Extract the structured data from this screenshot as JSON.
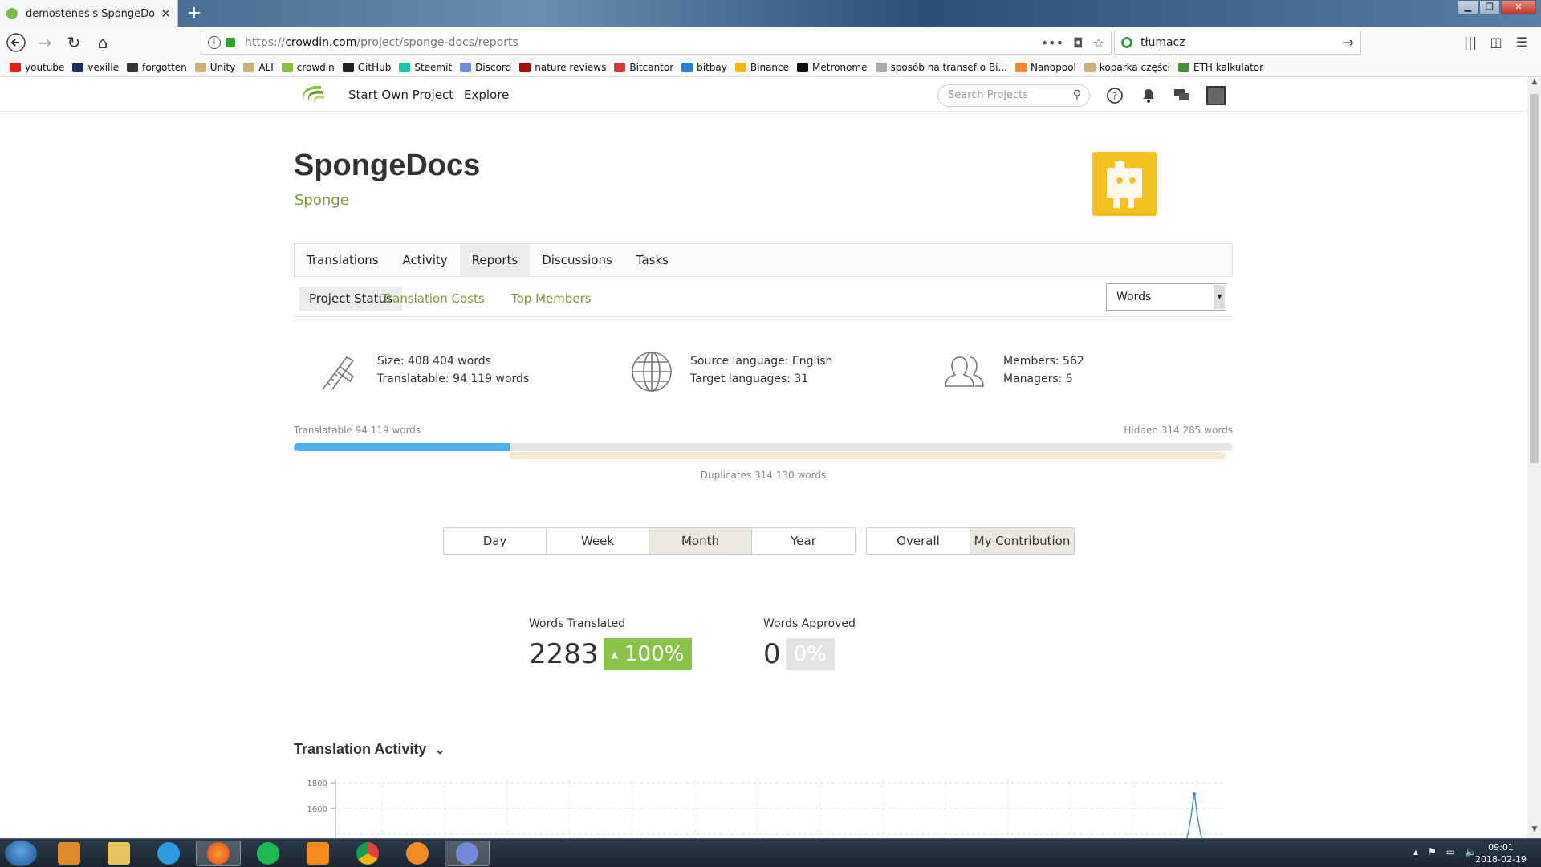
{
  "browser": {
    "tab_title": "demostenes's SpongeDocs Tra",
    "url_prefix": "https://",
    "url_domain": "crowdin.com",
    "url_path": "/project/sponge-docs/reports",
    "search_value": "tłumacz"
  },
  "bookmarks": [
    {
      "label": "youtube",
      "color": "#e62117"
    },
    {
      "label": "vexille",
      "color": "#1c2f5b"
    },
    {
      "label": "forgotten",
      "color": "#333333"
    },
    {
      "label": "Unity",
      "color": "#c9b27a"
    },
    {
      "label": "ALI",
      "color": "#c9b27a"
    },
    {
      "label": "crowdin",
      "color": "#8cbf3f"
    },
    {
      "label": "GitHub",
      "color": "#222222"
    },
    {
      "label": "Steemit",
      "color": "#1ec3a6"
    },
    {
      "label": "Discord",
      "color": "#7289da"
    },
    {
      "label": "nature reviews",
      "color": "#a01010"
    },
    {
      "label": "Bitcantor",
      "color": "#d23b3b"
    },
    {
      "label": "bitbay",
      "color": "#2a7fd4"
    },
    {
      "label": "Binance",
      "color": "#f0b90b"
    },
    {
      "label": "Metronome",
      "color": "#111111"
    },
    {
      "label": "sposób na transef o Bi...",
      "color": "#aaaaaa"
    },
    {
      "label": "Nanopool",
      "color": "#f28c28"
    },
    {
      "label": "koparka części",
      "color": "#c9b27a"
    },
    {
      "label": "ETH kalkulator",
      "color": "#4c8c3c"
    }
  ],
  "site_nav": {
    "start_project": "Start Own Project",
    "explore": "Explore",
    "search_placeholder": "Search Projects"
  },
  "project": {
    "title": "SpongeDocs",
    "owner": "Sponge"
  },
  "tabs": [
    "Translations",
    "Activity",
    "Reports",
    "Discussions",
    "Tasks"
  ],
  "subtabs": {
    "project_status": "Project Status",
    "translation_costs": "Translation Costs",
    "top_members": "Top Members",
    "unit_selected": "Words"
  },
  "stats": {
    "size": "Size: 408 404 words",
    "translatable": "Translatable: 94 119 words",
    "source_language": "Source language: English",
    "target_languages": "Target languages: 31",
    "members": "Members: 562",
    "managers": "Managers: 5"
  },
  "progress": {
    "left_label": "Translatable 94 119 words",
    "right_label": "Hidden 314 285 words",
    "duplicates_label": "Duplicates 314 130 words",
    "translatable_fraction": 0.23
  },
  "period_buttons": [
    "Day",
    "Week",
    "Month",
    "Year"
  ],
  "period_active": "Month",
  "scope_buttons": [
    "Overall",
    "My Contribution"
  ],
  "scope_active": "My Contribution",
  "metrics": {
    "translated_label": "Words Translated",
    "translated_value": "2283",
    "translated_pct": "100%",
    "approved_label": "Words Approved",
    "approved_value": "0",
    "approved_pct": "0%"
  },
  "activity": {
    "title": "Translation Activity",
    "y_ticks": [
      "1800",
      "1600"
    ]
  },
  "taskbar": {
    "time": "09:01",
    "date": "2018-02-19"
  }
}
